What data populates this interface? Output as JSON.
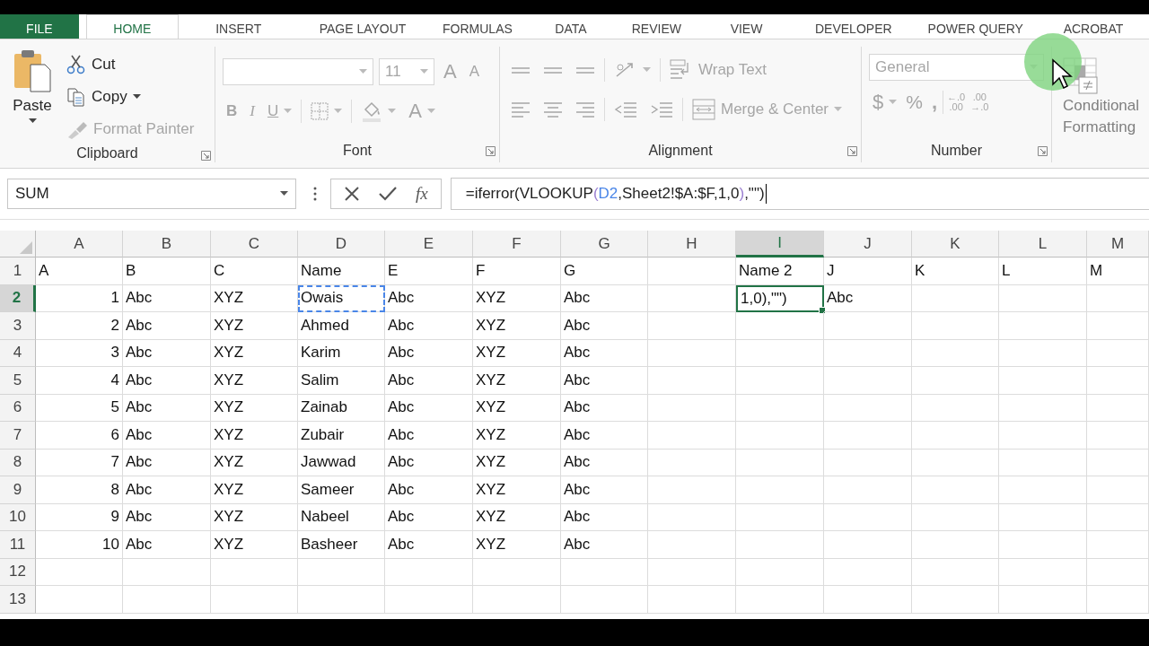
{
  "tabs": [
    {
      "label": "FILE",
      "kind": "file",
      "selected": false
    },
    {
      "label": "HOME",
      "kind": "tab",
      "selected": true
    },
    {
      "label": "INSERT",
      "kind": "tab",
      "selected": false
    },
    {
      "label": "PAGE LAYOUT",
      "kind": "tab",
      "selected": false
    },
    {
      "label": "FORMULAS",
      "kind": "tab",
      "selected": false
    },
    {
      "label": "DATA",
      "kind": "tab",
      "selected": false
    },
    {
      "label": "REVIEW",
      "kind": "tab",
      "selected": false
    },
    {
      "label": "VIEW",
      "kind": "tab",
      "selected": false
    },
    {
      "label": "DEVELOPER",
      "kind": "tab",
      "selected": false
    },
    {
      "label": "POWER QUERY",
      "kind": "tab",
      "selected": false
    },
    {
      "label": "ACROBAT",
      "kind": "tab",
      "selected": false
    }
  ],
  "ribbon": {
    "clipboard": {
      "title": "Clipboard",
      "paste": {
        "label": "Paste",
        "disabled": false
      },
      "cut": {
        "label": "Cut",
        "disabled": false
      },
      "copy": {
        "label": "Copy",
        "disabled": false
      },
      "format_painter": {
        "label": "Format Painter",
        "disabled": true
      }
    },
    "font": {
      "title": "Font",
      "disabled": true,
      "font_size": "11",
      "grow": "A",
      "shrink": "A",
      "bold": "B",
      "italic": "I",
      "underline": "U",
      "font_color": "A"
    },
    "alignment": {
      "title": "Alignment",
      "disabled": true,
      "wrap_text": "Wrap Text",
      "merge_center": "Merge & Center"
    },
    "number": {
      "title": "Number",
      "disabled": true,
      "format": "General",
      "currency": "$",
      "percent": "%",
      "comma": ",",
      "increase_decimal": [
        "←.0",
        ".00"
      ],
      "decrease_decimal": [
        ".00",
        "→.0"
      ]
    },
    "styles": {
      "disabled": true,
      "conditional_formatting": "Conditional Formatting"
    }
  },
  "formula_bar": {
    "name_box": "SUM",
    "function_label": "fx",
    "formula": [
      {
        "text": "=iferror(VLOOKUP"
      },
      {
        "text": "(",
        "color": "#9a7fd1"
      },
      {
        "text": "D2",
        "color": "#4a86e8"
      },
      {
        "text": ",Sheet2!$A:$F,1,0"
      },
      {
        "text": ")",
        "color": "#9a7fd1"
      },
      {
        "text": ",\"\")"
      }
    ]
  },
  "sheet": {
    "columns": [
      {
        "label": "A",
        "selected": false
      },
      {
        "label": "B",
        "selected": false
      },
      {
        "label": "C",
        "selected": false
      },
      {
        "label": "D",
        "selected": false
      },
      {
        "label": "E",
        "selected": false
      },
      {
        "label": "F",
        "selected": false
      },
      {
        "label": "G",
        "selected": false
      },
      {
        "label": "H",
        "selected": false
      },
      {
        "label": "I",
        "selected": true
      },
      {
        "label": "J",
        "selected": false
      },
      {
        "label": "K",
        "selected": false
      },
      {
        "label": "L",
        "selected": false
      },
      {
        "label": "M",
        "selected": false
      }
    ],
    "rows": [
      {
        "number": "1",
        "selected": false,
        "cells": [
          "A",
          "B",
          "C",
          "Name",
          "E",
          "F",
          "G",
          null,
          "Name 2",
          "J",
          "K",
          "L",
          "M"
        ]
      },
      {
        "number": "2",
        "selected": true,
        "cells": [
          {
            "text": "1",
            "kind": "number"
          },
          "Abc",
          "XYZ",
          {
            "text": "Owais",
            "marquee": true
          },
          "Abc",
          "XYZ",
          "Abc",
          null,
          {
            "text": "1,0),\"\")",
            "selected": true
          },
          "Abc"
        ]
      },
      {
        "number": "3",
        "selected": false,
        "cells": [
          {
            "text": "2",
            "kind": "number"
          },
          "Abc",
          "XYZ",
          "Ahmed",
          "Abc",
          "XYZ",
          "Abc"
        ]
      },
      {
        "number": "4",
        "selected": false,
        "cells": [
          {
            "text": "3",
            "kind": "number"
          },
          "Abc",
          "XYZ",
          "Karim",
          "Abc",
          "XYZ",
          "Abc"
        ]
      },
      {
        "number": "5",
        "selected": false,
        "cells": [
          {
            "text": "4",
            "kind": "number"
          },
          "Abc",
          "XYZ",
          "Salim",
          "Abc",
          "XYZ",
          "Abc"
        ]
      },
      {
        "number": "6",
        "selected": false,
        "cells": [
          {
            "text": "5",
            "kind": "number"
          },
          "Abc",
          "XYZ",
          "Zainab",
          "Abc",
          "XYZ",
          "Abc"
        ]
      },
      {
        "number": "7",
        "selected": false,
        "cells": [
          {
            "text": "6",
            "kind": "number"
          },
          "Abc",
          "XYZ",
          "Zubair",
          "Abc",
          "XYZ",
          "Abc"
        ]
      },
      {
        "number": "8",
        "selected": false,
        "cells": [
          {
            "text": "7",
            "kind": "number"
          },
          "Abc",
          "XYZ",
          "Jawwad",
          "Abc",
          "XYZ",
          "Abc"
        ]
      },
      {
        "number": "9",
        "selected": false,
        "cells": [
          {
            "text": "8",
            "kind": "number"
          },
          "Abc",
          "XYZ",
          "Sameer",
          "Abc",
          "XYZ",
          "Abc"
        ]
      },
      {
        "number": "10",
        "selected": false,
        "cells": [
          {
            "text": "9",
            "kind": "number"
          },
          "Abc",
          "XYZ",
          "Nabeel",
          "Abc",
          "XYZ",
          "Abc"
        ]
      },
      {
        "number": "11",
        "selected": false,
        "cells": [
          {
            "text": "10",
            "kind": "number"
          },
          "Abc",
          "XYZ",
          "Basheer",
          "Abc",
          "XYZ",
          "Abc"
        ]
      },
      {
        "number": "12",
        "selected": false
      },
      {
        "number": "13",
        "selected": false
      }
    ]
  }
}
